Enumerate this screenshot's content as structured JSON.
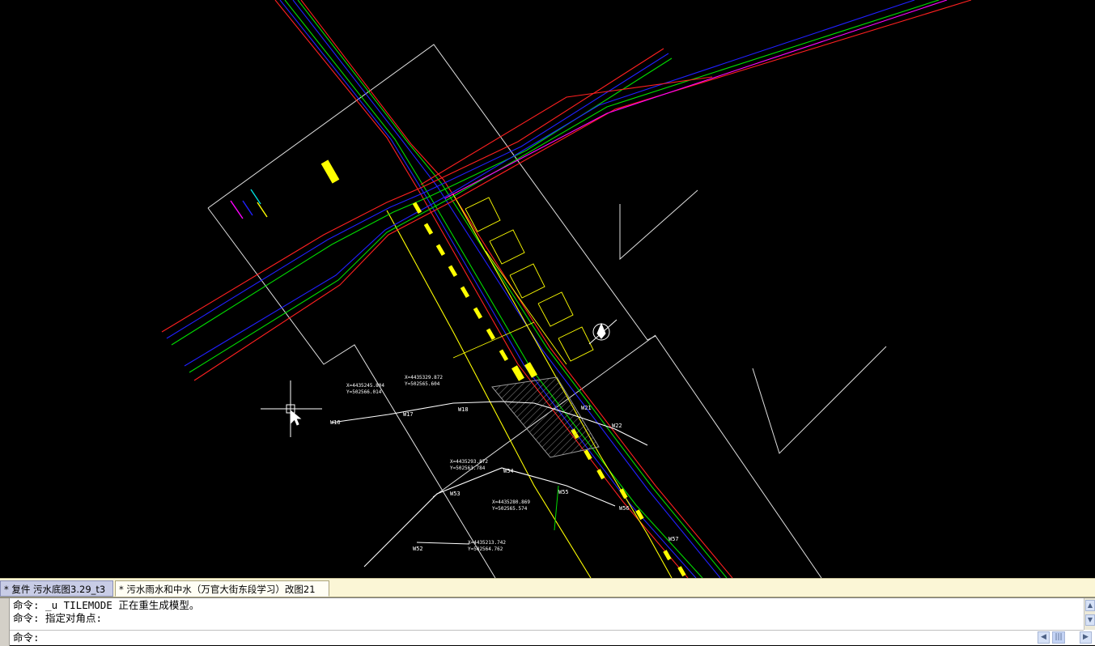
{
  "tabs": [
    {
      "label": "* 复件 污水底图3.29_t3",
      "active": true
    },
    {
      "label": "* 污水雨水和中水（万官大街东段学习）改图21",
      "active": false
    }
  ],
  "command_history": [
    "命令: _u TILEMODE 正在重生成模型。",
    "命令: 指定对角点:"
  ],
  "command_prompt": "命令:",
  "command_input": {
    "value": "",
    "placeholder": ""
  },
  "drawing_labels": {
    "wells": [
      "W16",
      "W17",
      "W18",
      "W21",
      "W22",
      "W52",
      "W53",
      "W54",
      "W55",
      "W56",
      "W57"
    ],
    "coords": [
      "X=4435329.872",
      "Y=502565.604",
      "X=4435245.804",
      "Y=502566.014",
      "X=4435293.872",
      "Y=502563.784",
      "X=4435280.869",
      "Y=502565.574",
      "X=4435213.742",
      "Y=502564.762"
    ]
  },
  "colors": {
    "background": "#000000",
    "road_edge": "#ff2020",
    "road_blue": "#2020ff",
    "road_green": "#00dd00",
    "road_magenta": "#ff00ff",
    "pipe_yellow": "#ffff00",
    "frame_white": "#ffffff",
    "tab_active": "#c8cce6",
    "tab_bar": "#fbf6d6"
  },
  "icons": [
    "crosshair-cursor-icon",
    "north-arrow-icon",
    "scroll-up-icon",
    "scroll-down-icon",
    "scroll-left-icon",
    "scroll-right-icon"
  ]
}
